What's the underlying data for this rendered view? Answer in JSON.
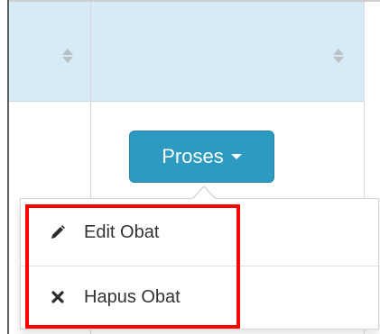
{
  "table": {
    "header_sort_icons": [
      "sort-icon",
      "sort-icon"
    ]
  },
  "action_button": {
    "label": "Proses",
    "icon": "caret-down-icon",
    "color": "#2d9bc1"
  },
  "dropdown": {
    "items": [
      {
        "label": "Edit Obat",
        "icon": "pencil-icon"
      },
      {
        "label": "Hapus Obat",
        "icon": "close-icon"
      }
    ]
  },
  "highlight_color": "#ff0000"
}
